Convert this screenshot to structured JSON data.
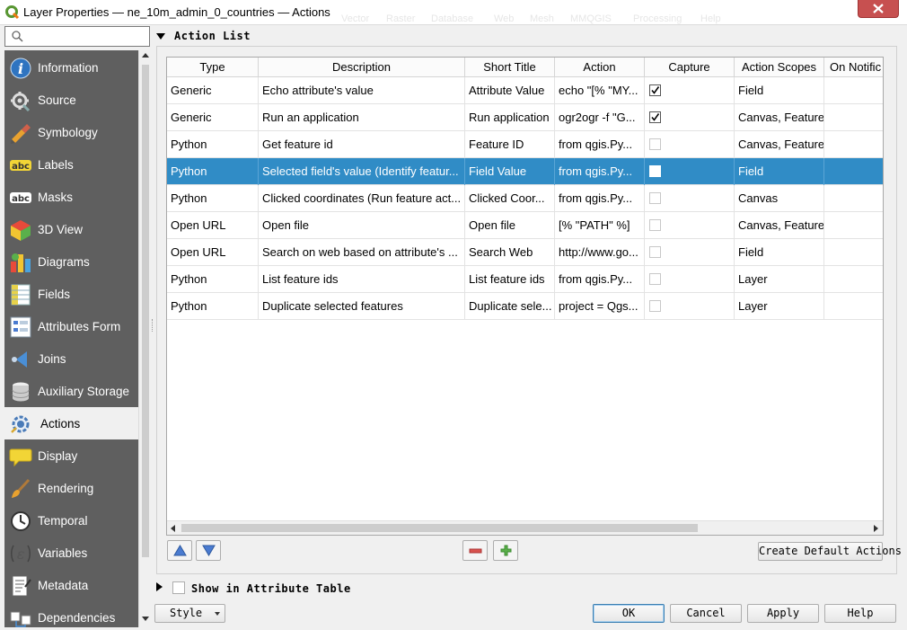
{
  "window": {
    "title": "Layer Properties — ne_10m_admin_0_countries — Actions",
    "background_menu_ghost": [
      "Vector",
      "Raster",
      "Database",
      "Web",
      "Mesh",
      "MMQGIS",
      "Processing",
      "Help"
    ]
  },
  "search": {
    "placeholder": "",
    "value": ""
  },
  "sidebar": {
    "items": [
      {
        "label": "Information",
        "icon": "information-icon"
      },
      {
        "label": "Source",
        "icon": "source-icon"
      },
      {
        "label": "Symbology",
        "icon": "symbology-icon"
      },
      {
        "label": "Labels",
        "icon": "labels-icon"
      },
      {
        "label": "Masks",
        "icon": "masks-icon"
      },
      {
        "label": "3D View",
        "icon": "3d-view-icon"
      },
      {
        "label": "Diagrams",
        "icon": "diagrams-icon"
      },
      {
        "label": "Fields",
        "icon": "fields-icon"
      },
      {
        "label": "Attributes Form",
        "icon": "attributes-form-icon"
      },
      {
        "label": "Joins",
        "icon": "joins-icon"
      },
      {
        "label": "Auxiliary Storage",
        "icon": "auxiliary-storage-icon"
      },
      {
        "label": "Actions",
        "icon": "actions-icon",
        "active": true
      },
      {
        "label": "Display",
        "icon": "display-icon"
      },
      {
        "label": "Rendering",
        "icon": "rendering-icon"
      },
      {
        "label": "Temporal",
        "icon": "temporal-icon"
      },
      {
        "label": "Variables",
        "icon": "variables-icon"
      },
      {
        "label": "Metadata",
        "icon": "metadata-icon"
      },
      {
        "label": "Dependencies",
        "icon": "dependencies-icon"
      }
    ]
  },
  "action_list": {
    "title": "Action List",
    "columns": [
      "Type",
      "Description",
      "Short Title",
      "Action",
      "Capture",
      "Action Scopes",
      "On Notific"
    ],
    "rows": [
      {
        "type": "Generic",
        "description": "Echo attribute's value",
        "short_title": "Attribute Value",
        "action": "echo \"[% \"MY...",
        "capture": true,
        "scopes": "Field",
        "on_notification": ""
      },
      {
        "type": "Generic",
        "description": "Run an application",
        "short_title": "Run application",
        "action": "ogr2ogr -f \"G...",
        "capture": true,
        "scopes": "Canvas, Feature",
        "on_notification": ""
      },
      {
        "type": "Python",
        "description": "Get feature id",
        "short_title": "Feature ID",
        "action": "from qgis.Py...",
        "capture": false,
        "scopes": "Canvas, Feature",
        "on_notification": ""
      },
      {
        "type": "Python",
        "description": "Selected field's value (Identify featur...",
        "short_title": "Field Value",
        "action": "from qgis.Py...",
        "capture": false,
        "scopes": "Field",
        "on_notification": "",
        "selected": true
      },
      {
        "type": "Python",
        "description": "Clicked coordinates (Run feature act...",
        "short_title": "Clicked Coor...",
        "action": "from qgis.Py...",
        "capture": false,
        "scopes": "Canvas",
        "on_notification": ""
      },
      {
        "type": "Open URL",
        "description": "Open file",
        "short_title": "Open file",
        "action": "[% \"PATH\" %]",
        "capture": false,
        "scopes": "Canvas, Feature",
        "on_notification": ""
      },
      {
        "type": "Open URL",
        "description": "Search on web based on attribute's ...",
        "short_title": "Search Web",
        "action": "http://www.go...",
        "capture": false,
        "scopes": "Field",
        "on_notification": ""
      },
      {
        "type": "Python",
        "description": "List feature ids",
        "short_title": "List feature ids",
        "action": "from qgis.Py...",
        "capture": false,
        "scopes": "Layer",
        "on_notification": ""
      },
      {
        "type": "Python",
        "description": "Duplicate selected features",
        "short_title": "Duplicate sele...",
        "action": "project = Qgs...",
        "capture": false,
        "scopes": "Layer",
        "on_notification": ""
      }
    ],
    "create_default_label": "Create Default Actions"
  },
  "show_in_attribute_table": {
    "label": "Show in Attribute Table",
    "checked": false
  },
  "footer": {
    "style_label": "Style",
    "ok_label": "OK",
    "cancel_label": "Cancel",
    "apply_label": "Apply",
    "help_label": "Help"
  },
  "colors": {
    "sidebar_bg": "#5f5f5f",
    "selection": "#308cc6",
    "close_button": "#c75050"
  }
}
